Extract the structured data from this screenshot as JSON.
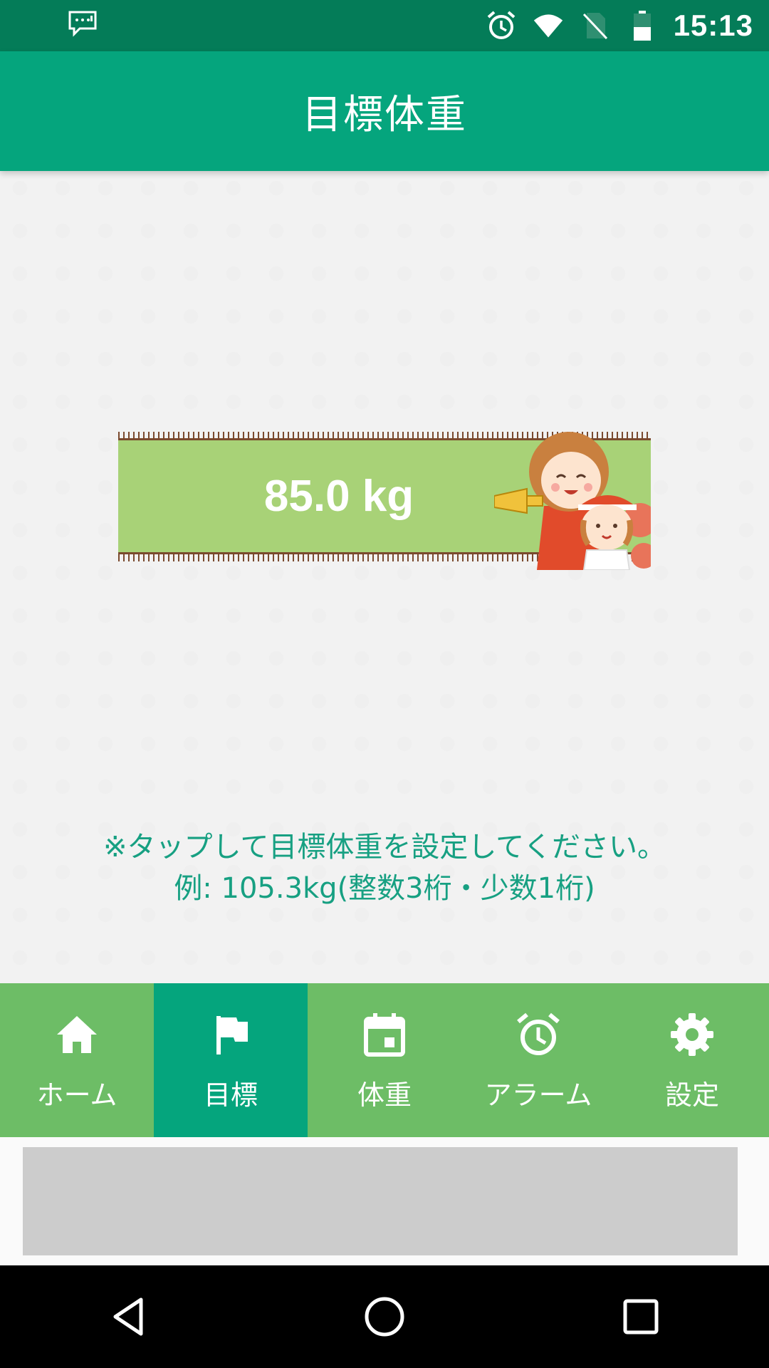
{
  "status_bar": {
    "time": "15:13",
    "icons": [
      "message-notification-icon",
      "alarm-icon",
      "wifi-icon",
      "no-sim-icon",
      "battery-icon"
    ]
  },
  "app_bar": {
    "title": "目標体重"
  },
  "weight_card": {
    "value": "85.0 kg",
    "illustration": "cheering-girls-illustration"
  },
  "hint": {
    "line1": "※タップして目標体重を設定してください。",
    "line2": "例: 105.3kg(整数3桁・少数1桁)"
  },
  "bottom_nav": {
    "active_index": 1,
    "items": [
      {
        "label": "ホーム",
        "icon": "home-icon"
      },
      {
        "label": "目標",
        "icon": "flag-icon"
      },
      {
        "label": "体重",
        "icon": "calendar-icon"
      },
      {
        "label": "アラーム",
        "icon": "alarm-clock-icon"
      },
      {
        "label": "設定",
        "icon": "gear-icon"
      }
    ]
  },
  "system_nav": {
    "buttons": [
      "back-icon",
      "home-circle-icon",
      "recents-icon"
    ]
  },
  "colors": {
    "status_bar": "#047c58",
    "primary": "#05a57d",
    "nav_bg": "#6dbd66",
    "weight_bar": "#a8d277",
    "hint_text": "#17a082"
  }
}
